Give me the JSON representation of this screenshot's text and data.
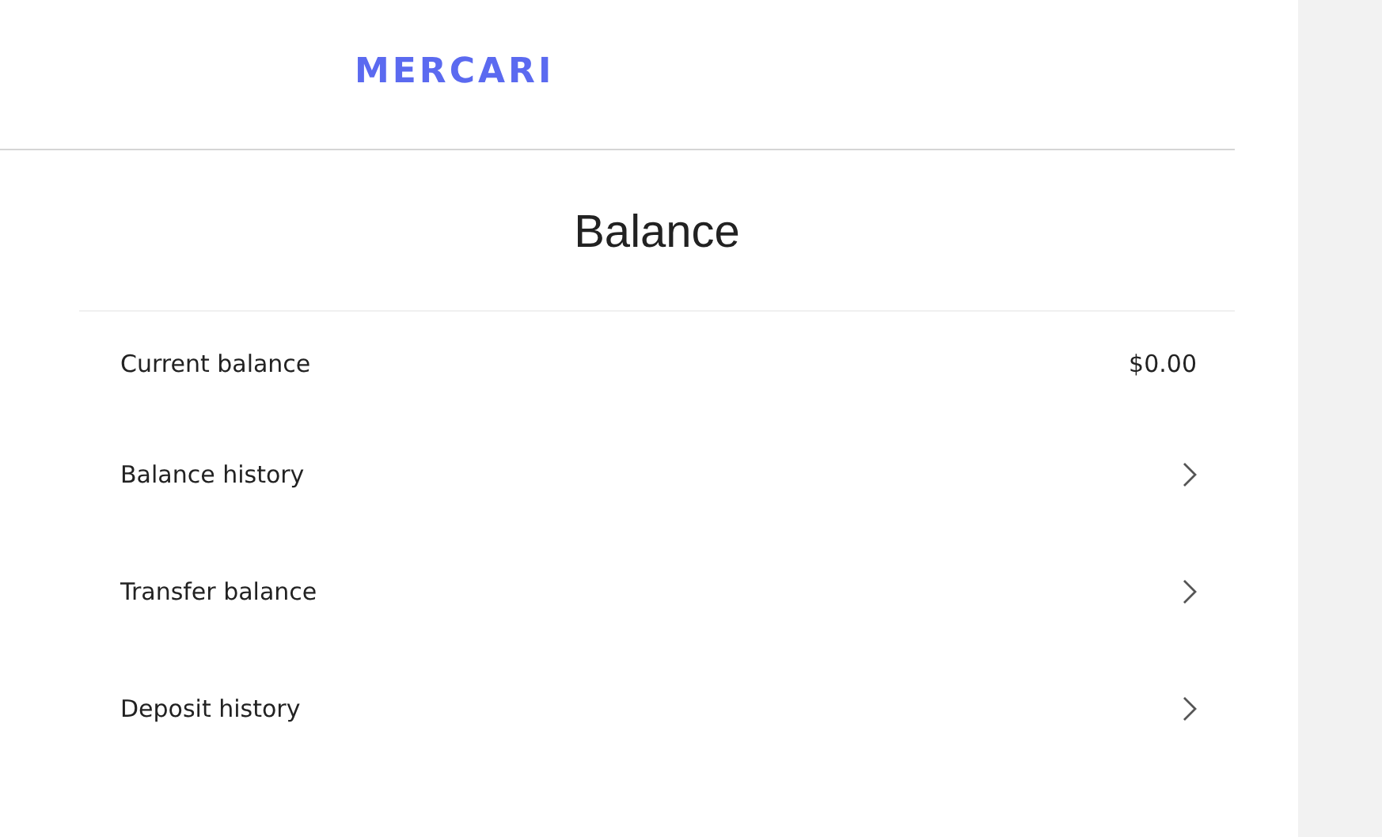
{
  "logo": "MERCARI",
  "title": "Balance",
  "rows": [
    {
      "kind": "value",
      "label": "Current balance",
      "value": "$0.00"
    },
    {
      "kind": "link",
      "label": "Balance history"
    },
    {
      "kind": "link",
      "label": "Transfer balance"
    },
    {
      "kind": "link",
      "label": "Deposit history"
    }
  ]
}
